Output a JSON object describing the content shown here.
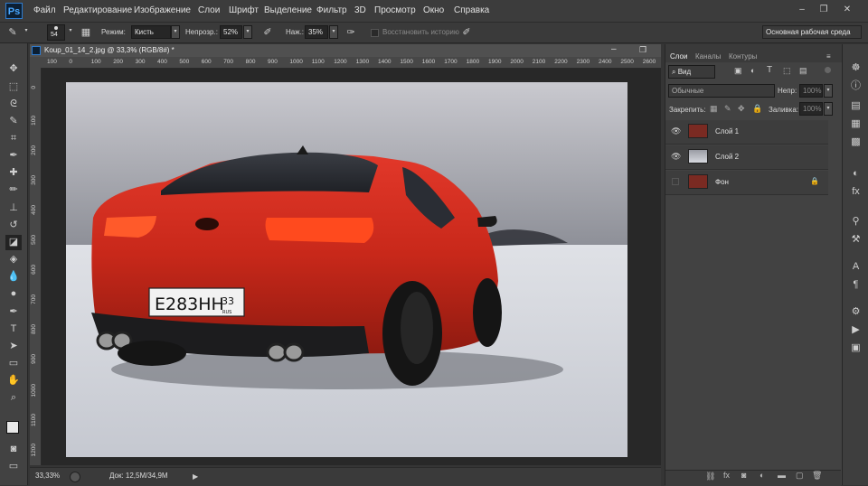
{
  "app": {
    "logo": "Ps"
  },
  "menu": [
    "Файл",
    "Редактирование",
    "Изображение",
    "Слои",
    "Шрифт",
    "Выделение",
    "Фильтр",
    "3D",
    "Просмотр",
    "Окно",
    "Справка"
  ],
  "window_controls": {
    "minimize": "–",
    "restore": "❐",
    "close": "✕"
  },
  "options": {
    "brush_size": "54",
    "mode_label": "Режим:",
    "mode_value": "Кисть",
    "opacity_label": "Непрозр.:",
    "opacity_value": "52%",
    "pressure_label": "Наж.:",
    "pressure_value": "35%",
    "restore_history": "Восстановить историю",
    "workspace": "Основная рабочая среда"
  },
  "document": {
    "tab_title": "Koup_01_14_2.jpg @ 33,3% (RGB/8#) *",
    "ruler_ticks": [
      "100",
      "0",
      "100",
      "200",
      "300",
      "400",
      "500",
      "600",
      "700",
      "800",
      "900",
      "1000",
      "1100",
      "1200",
      "1300",
      "1400",
      "1500",
      "1600",
      "1700",
      "1800",
      "1900",
      "2000",
      "2100",
      "2200",
      "2300",
      "2400",
      "2500",
      "2600"
    ],
    "ruler_left_ticks": [
      "0",
      "100",
      "200",
      "300",
      "400",
      "500",
      "600",
      "700",
      "800",
      "900",
      "1000",
      "1100",
      "1200"
    ],
    "plate_number": "E283HH",
    "plate_region": "33",
    "plate_country": "RUS"
  },
  "status": {
    "zoom": "33,33%",
    "doc_info": "Док: 12,5M/34,9M"
  },
  "layers_panel": {
    "tabs": [
      "Слои",
      "Каналы",
      "Контуры"
    ],
    "kind_filter": "Вид",
    "blend_mode": "Обычные",
    "opacity_label": "Непр:",
    "opacity_value": "100%",
    "lock_label": "Закрепить:",
    "fill_label": "Заливка:",
    "fill_value": "100%",
    "layers": [
      {
        "name": "Слой 1",
        "visible": true
      },
      {
        "name": "Слой 2",
        "visible": true
      },
      {
        "name": "Фон",
        "visible": false,
        "locked": true
      }
    ]
  },
  "colors": {
    "accent": "#2e7bcf",
    "car_red": "#c8281a",
    "ui_dark": "#353535"
  }
}
